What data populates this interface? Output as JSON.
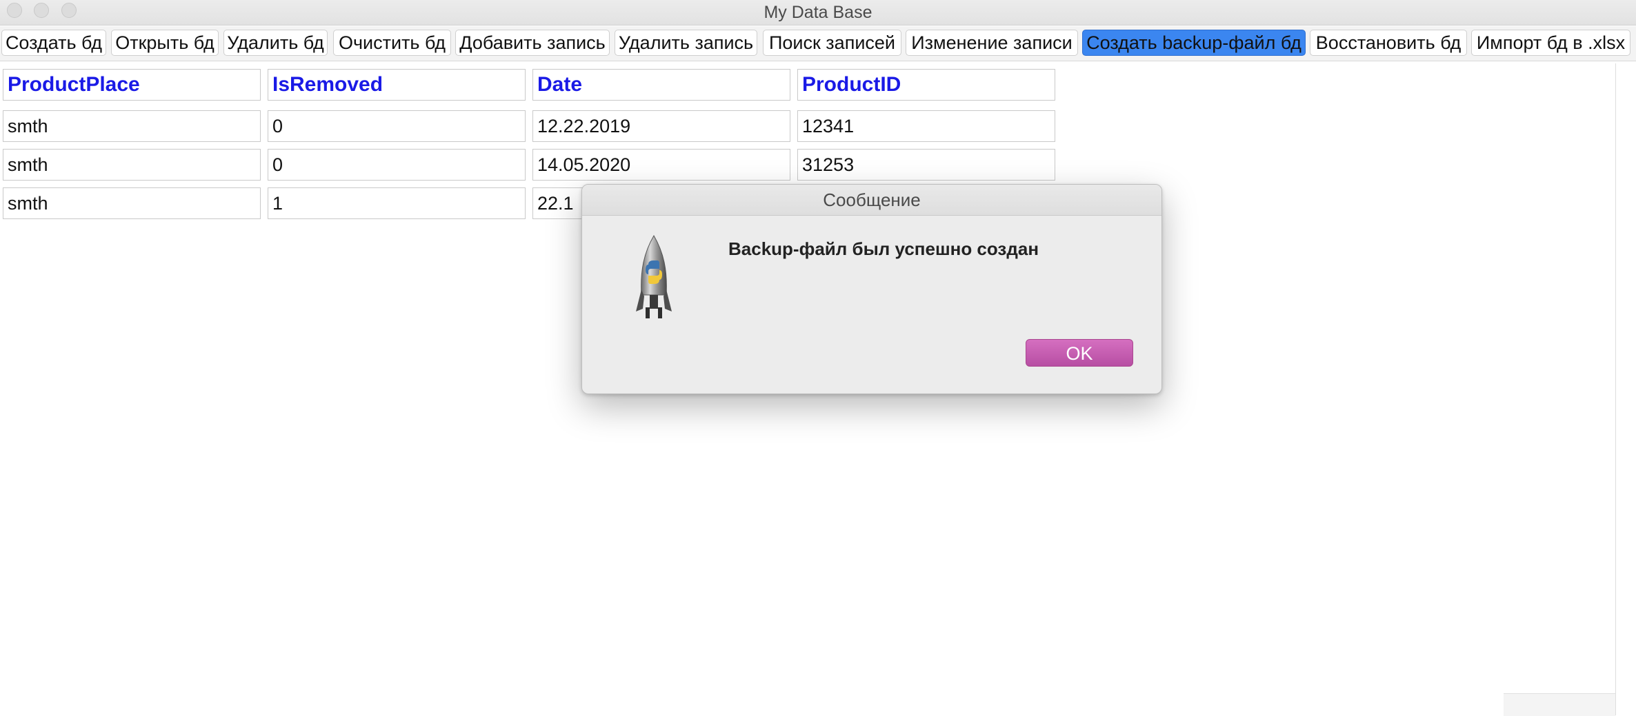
{
  "window": {
    "title": "My Data Base"
  },
  "toolbar": {
    "buttons": [
      "Создать бд",
      "Открыть бд",
      "Удалить бд",
      "Очистить бд",
      "Добавить запись",
      "Удалить запись",
      "Поиск записей",
      "Изменение записи",
      "Создать backup-файл бд",
      "Восстановить бд",
      "Импорт бд в .xlsx"
    ],
    "active_button": "Создать backup-файл бд"
  },
  "table": {
    "columns": [
      "ProductPlace",
      "IsRemoved",
      "Date",
      "ProductID"
    ],
    "rows": [
      [
        "smth",
        "0",
        "12.22.2019",
        "12341"
      ],
      [
        "smth",
        "0",
        "14.05.2020",
        "31253"
      ],
      [
        "smth",
        "1",
        "22.1",
        ""
      ]
    ]
  },
  "dialog": {
    "title": "Сообщение",
    "message": "Backup-файл был успешно создан",
    "ok_label": "OK",
    "icon": "python-launcher-rocket-icon"
  },
  "colors": {
    "header_text": "#1a1ae6",
    "active_button": "#3b86f0",
    "ok_button": "#c75db2"
  }
}
